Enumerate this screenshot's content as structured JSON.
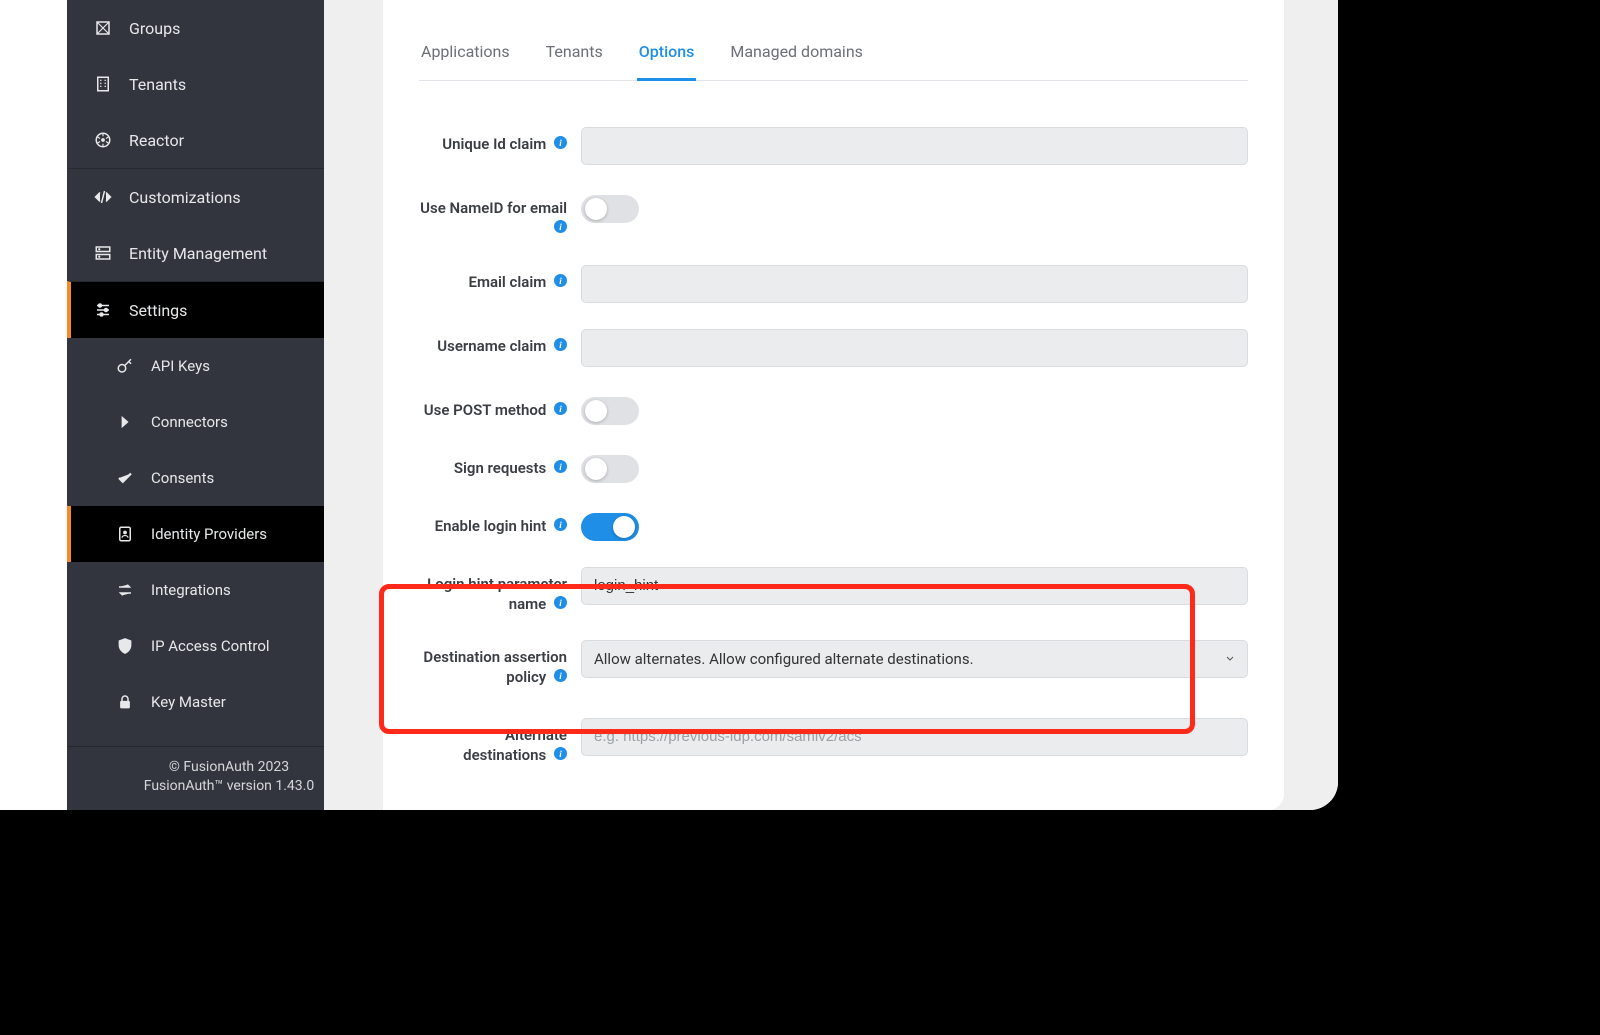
{
  "sidebar": {
    "items": [
      {
        "label": "Groups"
      },
      {
        "label": "Tenants"
      },
      {
        "label": "Reactor"
      },
      {
        "label": "Customizations"
      },
      {
        "label": "Entity Management"
      },
      {
        "label": "Settings"
      }
    ],
    "sub": [
      {
        "label": "API Keys"
      },
      {
        "label": "Connectors"
      },
      {
        "label": "Consents"
      },
      {
        "label": "Identity Providers"
      },
      {
        "label": "Integrations"
      },
      {
        "label": "IP Access Control"
      },
      {
        "label": "Key Master"
      }
    ],
    "footer": {
      "copyright": "© FusionAuth 2023",
      "version": "FusionAuth™ version 1.43.0"
    }
  },
  "tabs": [
    {
      "label": "Applications"
    },
    {
      "label": "Tenants"
    },
    {
      "label": "Options"
    },
    {
      "label": "Managed domains"
    }
  ],
  "active_tab": 2,
  "form": {
    "unique_id": {
      "label": "Unique Id claim",
      "value": ""
    },
    "use_nameid": {
      "label": "Use NameID for email",
      "on": false
    },
    "email_claim": {
      "label": "Email claim",
      "value": ""
    },
    "username_claim": {
      "label": "Username claim",
      "value": ""
    },
    "use_post": {
      "label": "Use POST method",
      "on": false
    },
    "sign_requests": {
      "label": "Sign requests",
      "on": false
    },
    "enable_login_hint": {
      "label": "Enable login hint",
      "on": true
    },
    "login_hint_param": {
      "label": "Login hint parameter name",
      "value": "login_hint"
    },
    "dest_policy": {
      "label": "Destination assertion policy",
      "value": "Allow alternates. Allow configured alternate destinations."
    },
    "alt_destinations": {
      "label": "Alternate destinations",
      "placeholder": "e.g. https://previous-idp.com/samlv2/acs",
      "value": ""
    }
  }
}
